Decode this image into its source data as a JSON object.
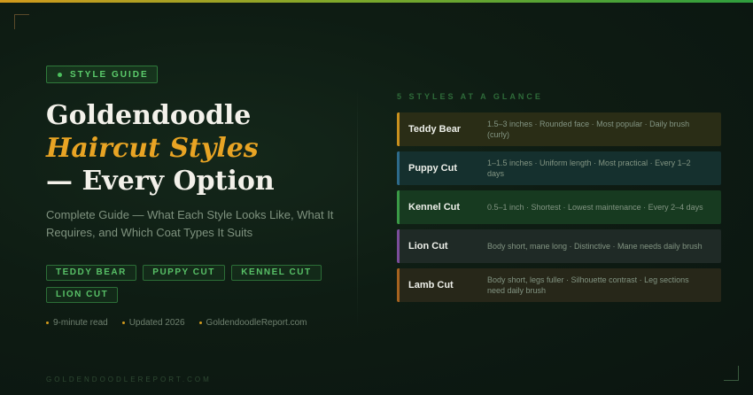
{
  "colors": {
    "accent_gold": "#e8a424",
    "accent_green": "#5ccd6c",
    "background": "#0e1c13"
  },
  "badge": {
    "label": "STYLE GUIDE"
  },
  "title": {
    "line1": "Goldendoodle",
    "line2": "Haircut Styles",
    "line3": "— Every Option"
  },
  "subtitle": "Complete Guide — What Each Style Looks Like, What It Requires, and Which Coat Types It Suits",
  "tags": [
    "TEDDY BEAR",
    "PUPPY CUT",
    "KENNEL CUT",
    "LION CUT"
  ],
  "meta": [
    "9-minute read",
    "Updated 2026",
    "GoldendoodleReport.com"
  ],
  "footer": "GOLDENDOODLEREPORT.COM",
  "glance_heading": "5 STYLES AT A GLANCE",
  "styles": [
    {
      "name": "Teddy Bear",
      "desc": "1.5–3 inches · Rounded face · Most popular · Daily brush (curly)",
      "border": "#c8901e",
      "bg": "#2a2d16"
    },
    {
      "name": "Puppy Cut",
      "desc": "1–1.5 inches · Uniform length · Most practical · Every 1–2 days",
      "border": "#2d6a8a",
      "bg": "#15302e"
    },
    {
      "name": "Kennel Cut",
      "desc": "0.5–1 inch · Shortest · Lowest maintenance · Every 2–4 days",
      "border": "#3a9a46",
      "bg": "#173a20"
    },
    {
      "name": "Lion Cut",
      "desc": "Body short, mane long · Distinctive · Mane needs daily brush",
      "border": "#7b4d9a",
      "bg": "#1f2a26"
    },
    {
      "name": "Lamb Cut",
      "desc": "Body short, legs fuller · Silhouette contrast · Leg sections need daily brush",
      "border": "#a5621f",
      "bg": "#272719"
    }
  ]
}
